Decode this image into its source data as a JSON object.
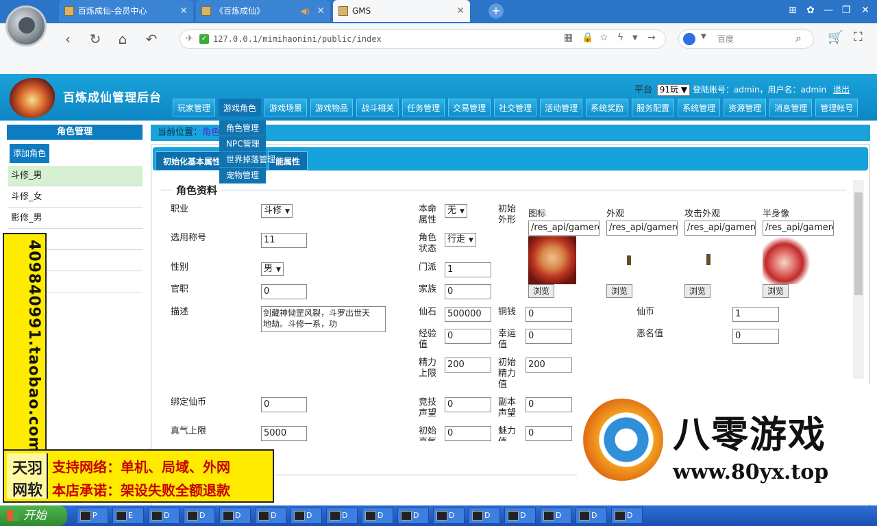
{
  "browser": {
    "tabs": [
      {
        "title": "百炼成仙-会员中心",
        "active": false
      },
      {
        "title": "《百炼成仙》",
        "active": false
      },
      {
        "title": "GMS",
        "active": true
      }
    ],
    "address": "127.0.0.1/mimihaonini/public/index",
    "search_placeholder": "百度",
    "win_controls": [
      "⊞",
      "✿",
      "—",
      "❐",
      "✕"
    ]
  },
  "admin": {
    "title": "百炼成仙管理后台",
    "platform_label": "平台",
    "platform_value": "91玩",
    "login_info": "登陆账号：admin，用户名：admin",
    "logout": "退出",
    "nav": [
      "玩家管理",
      "游戏角色",
      "游戏场景",
      "游戏物品",
      "战斗相关",
      "任务管理",
      "交易管理",
      "社交管理",
      "活动管理",
      "系统奖励",
      "服务配置",
      "系统管理",
      "资源管理",
      "消息管理",
      "管理帐号"
    ],
    "active_nav": 1,
    "dropdown": [
      "角色管理",
      "NPC管理",
      "世界掉落管理",
      "宠物管理"
    ]
  },
  "sidebar": {
    "title": "角色管理",
    "add_button": "添加角色",
    "items": [
      "斗修_男",
      "斗修_女",
      "影修_男"
    ]
  },
  "breadcrumb": {
    "label": "当前位置：",
    "current": "角色"
  },
  "tabs": [
    "初始化基本属性",
    "能属性"
  ],
  "section_title": "角色资料",
  "form": {
    "job_label": "职业",
    "job_value": "斗修",
    "title_label": "选用称号",
    "title_value": "11",
    "gender_label": "性别",
    "gender_value": "男",
    "official_label": "官职",
    "official_value": "0",
    "desc_label": "描述",
    "desc_value": "剑藏神恸罡风裂，斗罗出世天地劫。斗修一系，功",
    "element_label": "本命属性",
    "element_value": "无",
    "state_label": "角色状态",
    "state_value": "行走",
    "sect_label": "门派",
    "sect_value": "1",
    "family_label": "家族",
    "family_value": "0",
    "stone_label": "仙石",
    "stone_value": "500000",
    "exp_label": "经验值",
    "exp_value": "0",
    "energy_max_label": "精力上限",
    "energy_max_value": "200",
    "arena_label": "竞技声望",
    "arena_value": "0",
    "init_qi_label": "初始真气",
    "init_qi_value": "0",
    "copper_label": "铜钱",
    "copper_value": "0",
    "luck_label": "幸运值",
    "luck_value": "0",
    "init_energy_label": "初始精力值",
    "init_energy_value": "200",
    "dungeon_label": "副本声望",
    "dungeon_value": "0",
    "charm_label": "魅力值",
    "charm_value": "0",
    "coin_label": "仙币",
    "coin_value": "1",
    "evil_label": "恶名值",
    "evil_value": "0",
    "bound_coin_label": "绑定仙币",
    "bound_coin_value": "0",
    "qi_max_label": "真气上限",
    "qi_max_value": "5000",
    "appearance_label": "初始外形",
    "images": [
      {
        "label": "图标",
        "path": "/res_api/gamere"
      },
      {
        "label": "外观",
        "path": "/res_api/gamere"
      },
      {
        "label": "攻击外观",
        "path": "/res_api/gamere"
      },
      {
        "label": "半身像",
        "path": "/res_api/gamere"
      }
    ],
    "browse": "浏览"
  },
  "overlay": {
    "shop_id": "409840991.taobao.com",
    "shop_logo": [
      "天羽",
      "网软"
    ],
    "promo": [
      "支持网络：单机、局域、外网",
      "本店承诺：架设失败全额退款"
    ],
    "wm_title": "八零游戏",
    "wm_url": "www.80yx.top"
  },
  "taskbar": {
    "start": "开始",
    "buttons": [
      "P",
      "E",
      "D",
      "D",
      "D",
      "D",
      "D",
      "D",
      "D",
      "D",
      "D",
      "D",
      "D",
      "D",
      "D",
      "D"
    ]
  }
}
